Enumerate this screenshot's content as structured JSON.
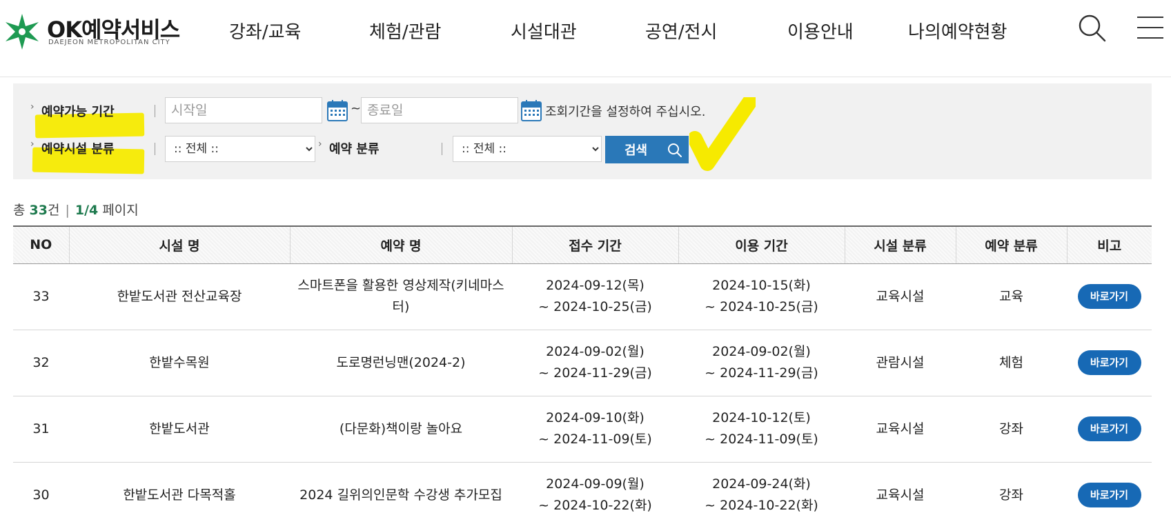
{
  "brand": {
    "title": "OK예약서비스",
    "subtitle": "DAEJEON METROPOLITAN CITY",
    "color": "#1e9a52"
  },
  "nav": {
    "items": [
      "강좌/교육",
      "체험/관람",
      "시설대관",
      "공연/전시",
      "이용안내",
      "나의예약현황"
    ]
  },
  "filter": {
    "period_label": "예약가능 기간",
    "start_placeholder": "시작일",
    "end_placeholder": "종료일",
    "tilde": "~",
    "hint": "조회기간을 설정하여 주십시오.",
    "facility_label": "예약시설 분류",
    "facility_selected": ":: 전체 ::",
    "reservation_label": "예약 분류",
    "reservation_selected": ":: 전체 ::",
    "search_button": "검색"
  },
  "summary": {
    "total_prefix": "총",
    "total_count": "33",
    "total_suffix": "건",
    "separator": "|",
    "page": "1/4",
    "page_suffix": "페이지"
  },
  "table": {
    "headers": [
      "NO",
      "시설 명",
      "예약 명",
      "접수 기간",
      "이용 기간",
      "시설 분류",
      "예약 분류",
      "비고"
    ],
    "rows": [
      {
        "no": "33",
        "facility": "한밭도서관 전산교육장",
        "name": "스마트폰을 활용한 영상제작(키네마스터)",
        "reception": "2024-09-12(목)\n~ 2024-10-25(금)",
        "usage": "2024-10-15(화)\n~ 2024-10-25(금)",
        "facility_type": "교육시설",
        "reservation_type": "교육",
        "action": "바로가기"
      },
      {
        "no": "32",
        "facility": "한밭수목원",
        "name": "도로명런닝맨(2024-2)",
        "reception": "2024-09-02(월)\n~ 2024-11-29(금)",
        "usage": "2024-09-02(월)\n~ 2024-11-29(금)",
        "facility_type": "관람시설",
        "reservation_type": "체험",
        "action": "바로가기"
      },
      {
        "no": "31",
        "facility": "한밭도서관",
        "name": "(다문화)책이랑 놀아요",
        "reception": "2024-09-10(화)\n~ 2024-11-09(토)",
        "usage": "2024-10-12(토)\n~ 2024-11-09(토)",
        "facility_type": "교육시설",
        "reservation_type": "강좌",
        "action": "바로가기"
      },
      {
        "no": "30",
        "facility": "한밭도서관 다목적홀",
        "name": "2024 길위의인문학 수강생 추가모집",
        "reception": "2024-09-09(월)\n~ 2024-10-22(화)",
        "usage": "2024-09-24(화)\n~ 2024-10-22(화)",
        "facility_type": "교육시설",
        "reservation_type": "강좌",
        "action": "바로가기"
      }
    ]
  },
  "colors": {
    "accent_blue": "#2a78b8",
    "button_blue": "#1769b5",
    "highlight": "#f6ea00",
    "count_green": "#1e7a4e"
  }
}
